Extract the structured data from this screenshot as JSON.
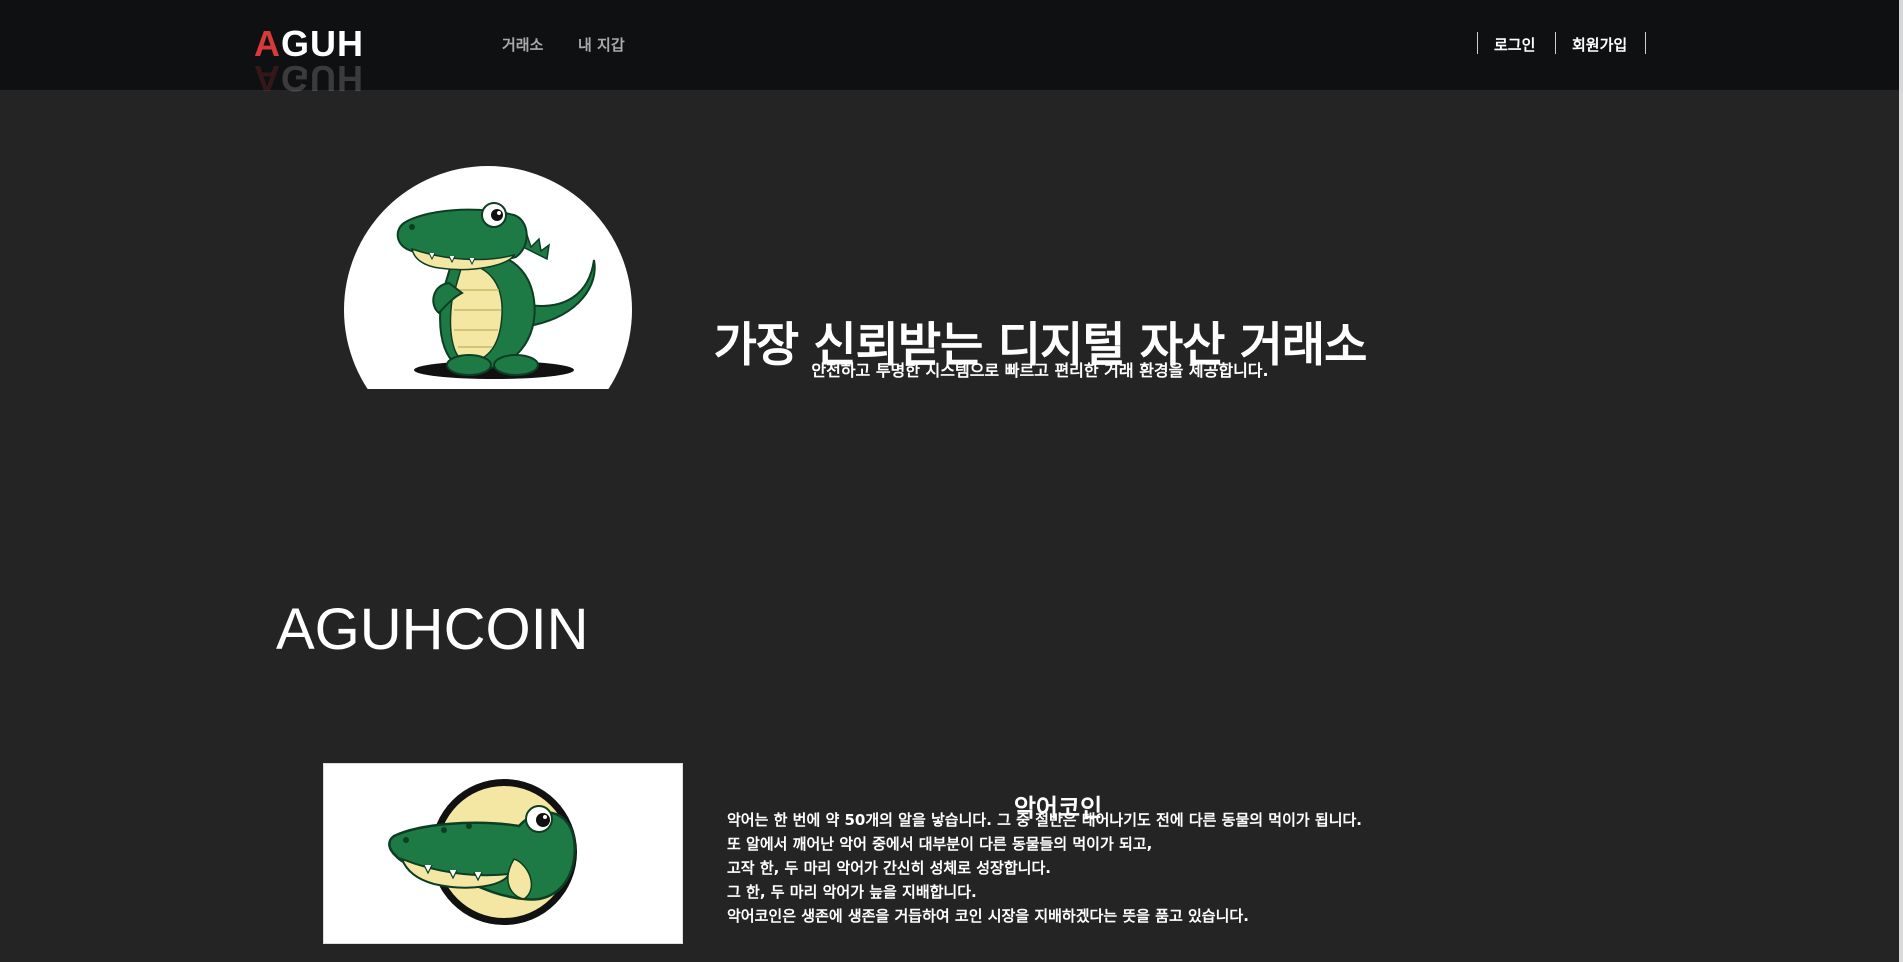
{
  "header": {
    "logo": {
      "first_letter": "A",
      "rest": "GUH"
    },
    "nav": {
      "exchange_label": "거래소",
      "wallet_label": "내 지갑"
    },
    "auth": {
      "login_label": "로그인",
      "signup_label": "회원가입"
    }
  },
  "hero": {
    "title": "가장 신뢰받는 디지털 자산 거래소",
    "subtitle": "안전하고 투명한 시스템으로 빠르고 편리한 거래 환경을 제공합니다.",
    "mascot_icon": "crocodile-mascot-icon"
  },
  "section": {
    "title": "AGUHCOIN"
  },
  "coin": {
    "name": "악어코인",
    "icon": "crocodile-coin-icon",
    "description": [
      "악어는 한 번에 약 50개의 알을 낳습니다. 그 중 절반은 태어나기도 전에 다른 동물의 먹이가 됩니다.",
      "또 알에서 깨어난 악어 중에서 대부분이 다른 동물들의 먹이가 되고,",
      "고작 한, 두 마리 악어가 간신히 성체로 성장합니다.",
      "그 한, 두 마리 악어가 늪을 지배합니다.",
      "악어코인은 생존에 생존을 거듭하여 코인 시장을 지배하겠다는 뜻을 품고 있습니다."
    ]
  },
  "colors": {
    "header_bg": "#0f1012",
    "page_bg": "#242424",
    "logo_accent": "#d63a3a",
    "croc_green": "#1e7a45",
    "croc_belly": "#f3e7a3"
  }
}
